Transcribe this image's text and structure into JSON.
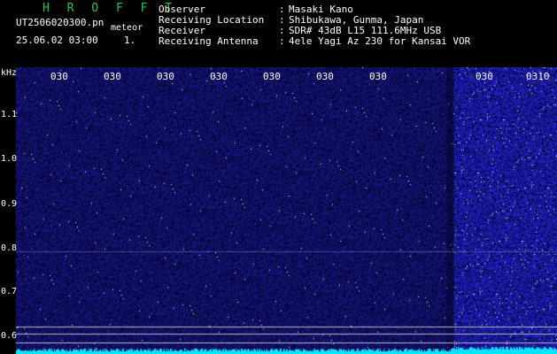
{
  "header": {
    "title": "H R O F F T",
    "filename": "UT2506020300.pn",
    "meteor_label": "meteor",
    "datetime": "25.06.02 03:00",
    "scale": "1.",
    "info": [
      {
        "label": "Observer",
        "value": "Masaki Kano"
      },
      {
        "label": "Receiving Location",
        "value": "Shibukawa, Gunma, Japan"
      },
      {
        "label": "Receiver",
        "value": "SDR# 43dB L15 111.6MHz USB"
      },
      {
        "label": "Receiving Antenna",
        "value": "4ele Yagi Az 230 for Kansai VOR"
      }
    ],
    "colon": ":"
  },
  "axis": {
    "y_unit": "kHz",
    "y_ticks": [
      "1.1",
      "1.0",
      "0.9",
      "0.8",
      "0.7",
      "0.6"
    ],
    "x_ticks": [
      "030",
      "030",
      "030",
      "030",
      "030",
      "030",
      "030",
      "030",
      "0310"
    ]
  },
  "colors": {
    "noise": "#2a2a9a",
    "dots": "#ffffff",
    "signal": "#00e5ff",
    "reference_lines": "#b8b8c8",
    "title": "#22c55e"
  }
}
